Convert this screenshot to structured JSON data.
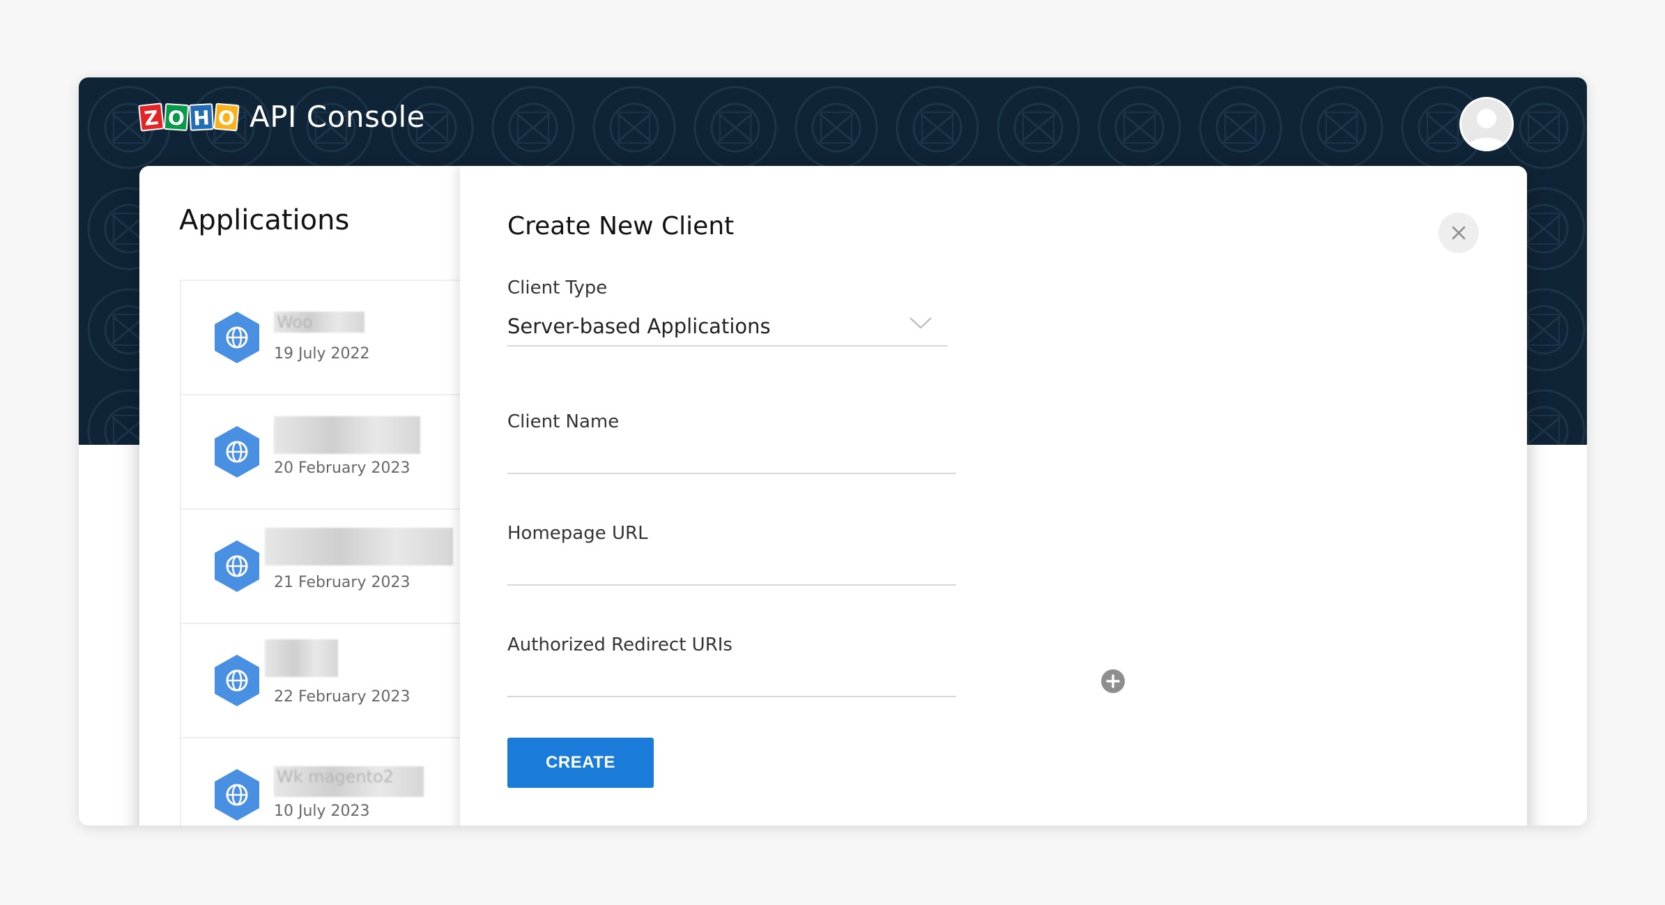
{
  "header": {
    "logo_letters": [
      "Z",
      "O",
      "H",
      "O"
    ],
    "logo_colors": [
      "#e42527",
      "#089949",
      "#226db4",
      "#f9b21d"
    ],
    "title": "API Console",
    "background": "#0f2436"
  },
  "applications": {
    "title": "Applications",
    "items": [
      {
        "name": "Woo",
        "date": "19 July 2022",
        "icon": "globe-icon"
      },
      {
        "name": "",
        "date": "20 February 2023",
        "icon": "globe-icon"
      },
      {
        "name": "",
        "date": "21 February 2023",
        "icon": "globe-icon"
      },
      {
        "name": "",
        "date": "22 February 2023",
        "icon": "globe-icon"
      },
      {
        "name": "Wk magento2",
        "date": "10 July 2023",
        "icon": "globe-icon"
      }
    ],
    "icon_color": "#4a90e2"
  },
  "modal": {
    "title": "Create New Client",
    "close_icon": "close-icon",
    "client_type": {
      "label": "Client Type",
      "value": "Server-based Applications"
    },
    "client_name": {
      "label": "Client Name",
      "value": ""
    },
    "homepage_url": {
      "label": "Homepage URL",
      "value": ""
    },
    "redirect_uris": {
      "label": "Authorized Redirect URIs",
      "value": "",
      "add_icon": "plus-circle-icon"
    },
    "create_label": "CREATE",
    "accent": "#1a7cd8"
  }
}
